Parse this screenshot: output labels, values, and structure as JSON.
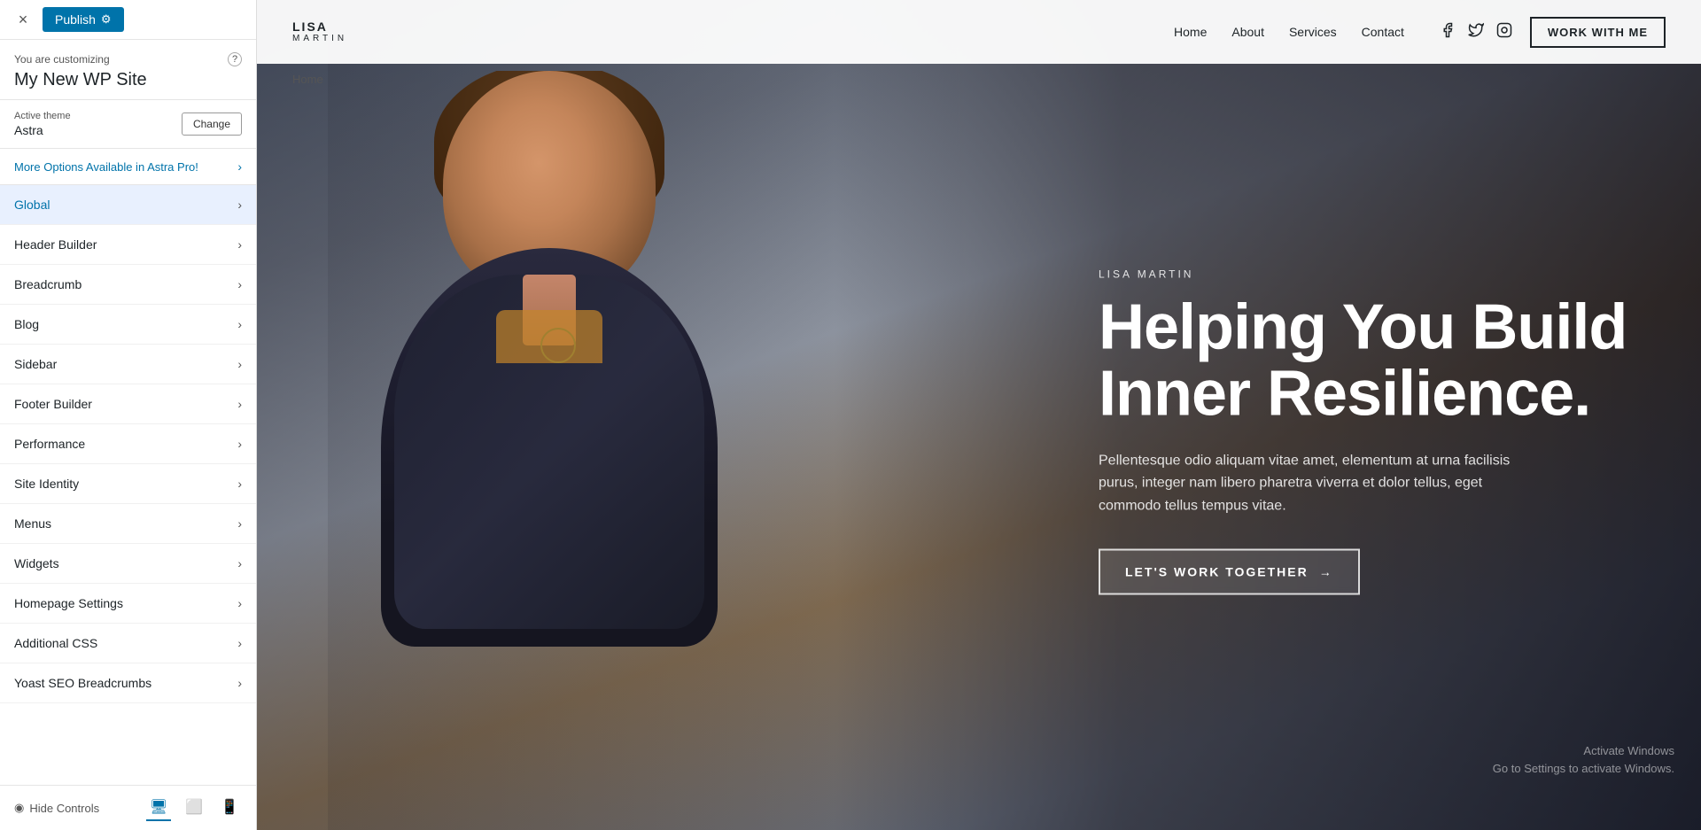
{
  "panel": {
    "close_icon": "×",
    "publish_label": "Publish",
    "gear_icon": "⚙",
    "customizing_label": "You are customizing",
    "help_icon": "?",
    "site_name": "My New WP Site",
    "theme_label": "Active theme",
    "theme_name": "Astra",
    "change_label": "Change",
    "astra_pro_text": "More Options Available in Astra Pro!",
    "menu_items": [
      {
        "label": "Global",
        "active": true
      },
      {
        "label": "Header Builder",
        "active": false
      },
      {
        "label": "Breadcrumb",
        "active": false
      },
      {
        "label": "Blog",
        "active": false
      },
      {
        "label": "Sidebar",
        "active": false
      },
      {
        "label": "Footer Builder",
        "active": false
      },
      {
        "label": "Performance",
        "active": false
      },
      {
        "label": "Site Identity",
        "active": false
      },
      {
        "label": "Menus",
        "active": false
      },
      {
        "label": "Widgets",
        "active": false
      },
      {
        "label": "Homepage Settings",
        "active": false
      },
      {
        "label": "Additional CSS",
        "active": false
      },
      {
        "label": "Yoast SEO Breadcrumbs",
        "active": false
      }
    ],
    "hide_controls_label": "Hide Controls"
  },
  "preview": {
    "logo_name": "LISA",
    "logo_surname": "MARTIN",
    "nav_items": [
      "Home",
      "About",
      "Services",
      "Contact"
    ],
    "social_icons": [
      "facebook",
      "twitter",
      "instagram"
    ],
    "work_with_me_label": "WORK WITH ME",
    "breadcrumb": "Home",
    "hero_subtitle": "LISA MARTIN",
    "hero_title": "Helping You Build Inner Resilience.",
    "hero_desc": "Pellentesque odio aliquam vitae amet, elementum at urna facilisis purus, integer nam libero pharetra viverra et dolor tellus, eget commodo tellus tempus vitae.",
    "cta_label": "LET'S WORK TOGETHER",
    "cta_arrow": "→",
    "activate_windows_line1": "Activate Windows",
    "activate_windows_line2": "Go to Settings to activate Windows."
  }
}
